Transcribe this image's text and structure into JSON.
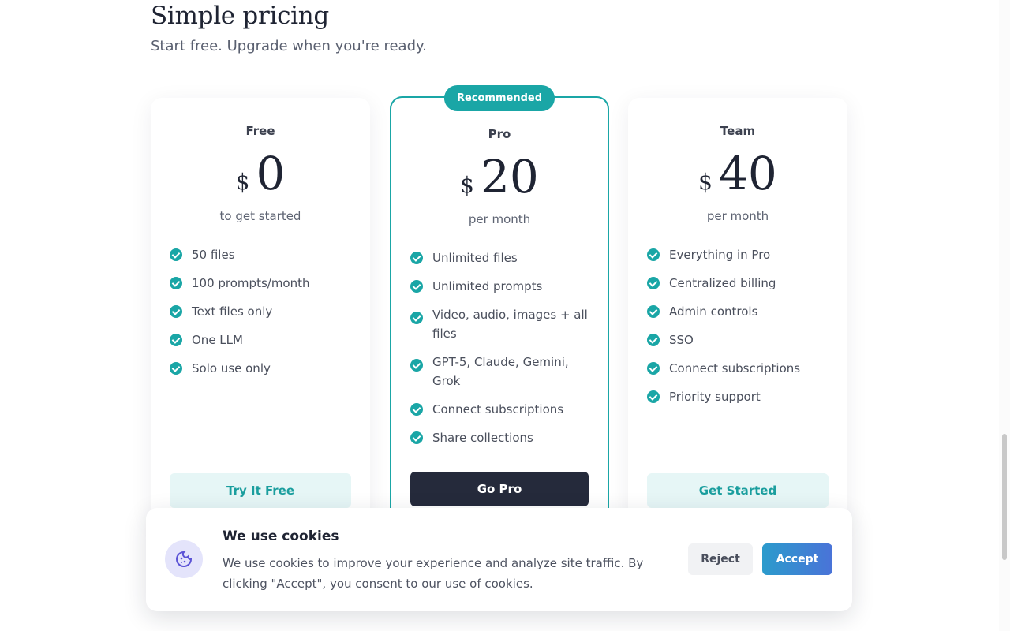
{
  "header": {
    "title": "Simple pricing",
    "subtitle": "Start free. Upgrade when you're ready."
  },
  "plans": [
    {
      "name": "Free",
      "currency": "$",
      "amount": "0",
      "period": "to get started",
      "features": [
        "50 files",
        "100 prompts/month",
        "Text files only",
        "One LLM",
        "Solo use only"
      ],
      "cta": "Try It Free"
    },
    {
      "name": "Pro",
      "badge": "Recommended",
      "currency": "$",
      "amount": "20",
      "period": "per month",
      "features": [
        "Unlimited files",
        "Unlimited prompts",
        "Video, audio, images + all files",
        "GPT-5, Claude, Gemini, Grok",
        "Connect subscriptions",
        "Share collections"
      ],
      "cta": "Go Pro"
    },
    {
      "name": "Team",
      "currency": "$",
      "amount": "40",
      "period": "per month",
      "features": [
        "Everything in Pro",
        "Centralized billing",
        "Admin controls",
        "SSO",
        "Connect subscriptions",
        "Priority support"
      ],
      "cta": "Get Started"
    }
  ],
  "cookie_banner": {
    "icon": "cookie-icon",
    "title": "We use cookies",
    "text": "We use cookies to improve your experience and analyze site traffic. By clicking \"Accept\", you consent to our use of cookies.",
    "reject_label": "Reject",
    "accept_label": "Accept"
  },
  "colors": {
    "accent": "#1aa6a6",
    "dark_button": "#252a3b",
    "light_button": "#e6f6f6"
  }
}
